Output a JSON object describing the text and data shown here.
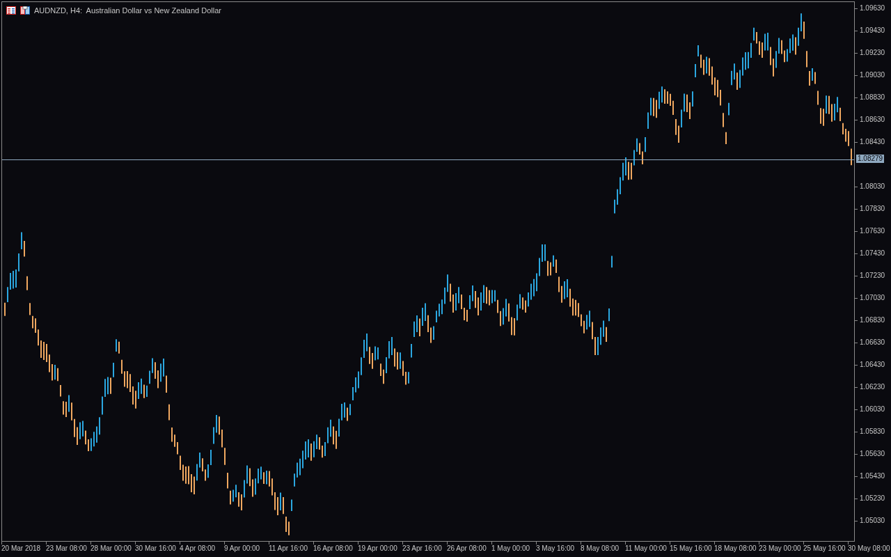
{
  "chart": {
    "title": "AUDNZD, H4:  Australian Dollar vs New Zealand Dollar"
  },
  "price_axis": {
    "ticks": [
      "1.09630",
      "1.09430",
      "1.09230",
      "1.09030",
      "1.08830",
      "1.08630",
      "1.08430",
      "1.08030",
      "1.07830",
      "1.07630",
      "1.07430",
      "1.07230",
      "1.07030",
      "1.06830",
      "1.06630",
      "1.06430",
      "1.06230",
      "1.06030",
      "1.05830",
      "1.05630",
      "1.05430",
      "1.05230",
      "1.05030"
    ],
    "current_price": "1.08279"
  },
  "time_axis": {
    "ticks": [
      "20 Mar 2018",
      "23 Mar 08:00",
      "28 Mar 00:00",
      "30 Mar 16:00",
      "4 Apr 08:00",
      "9 Apr 00:00",
      "11 Apr 16:00",
      "16 Apr 08:00",
      "19 Apr 00:00",
      "23 Apr 16:00",
      "26 Apr 08:00",
      "1 May 00:00",
      "3 May 16:00",
      "8 May 08:00",
      "11 May 00:00",
      "15 May 16:00",
      "18 May 08:00",
      "23 May 00:00",
      "25 May 16:00",
      "30 May 08:00"
    ]
  }
}
